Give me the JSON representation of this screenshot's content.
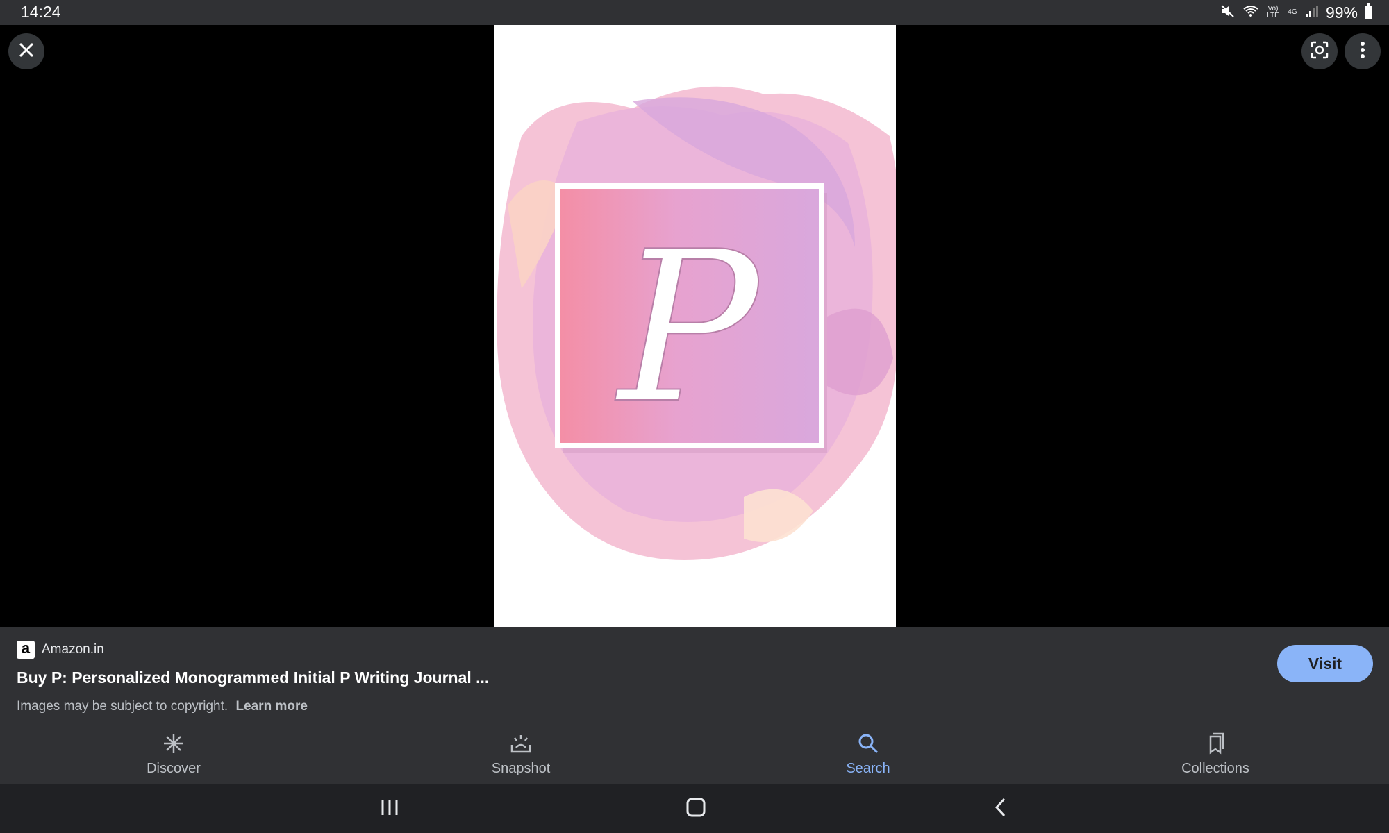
{
  "status_bar": {
    "time": "14:24",
    "battery_percent": "99%",
    "network_volte": "Vo) LTE",
    "network_4g": "4G",
    "icons": [
      "mute-icon",
      "wifi-icon",
      "volte-icon",
      "4g-icon",
      "signal-icon",
      "battery-icon"
    ]
  },
  "viewer": {
    "close_icon": "close-icon",
    "lens_icon": "lens-icon",
    "more_icon": "more-vert-icon",
    "image": {
      "monogram_letter": "P",
      "colors": {
        "frame": "#ffffff",
        "pink": "#f39ab3",
        "lavender": "#d8a8dc"
      }
    }
  },
  "info": {
    "source_logo": "a",
    "source_name": "Amazon.in",
    "title": "Buy P: Personalized Monogrammed Initial P Writing Journal ...",
    "copyright_text": "Images may be subject to copyright.",
    "learn_more": "Learn more",
    "visit_label": "Visit"
  },
  "bottom_nav": {
    "items": [
      {
        "label": "Discover",
        "icon": "discover-icon",
        "active": false
      },
      {
        "label": "Snapshot",
        "icon": "snapshot-icon",
        "active": false
      },
      {
        "label": "Search",
        "icon": "search-icon",
        "active": true
      },
      {
        "label": "Collections",
        "icon": "collections-icon",
        "active": false
      }
    ]
  },
  "system_nav": {
    "icons": [
      "recents-icon",
      "home-icon",
      "back-icon"
    ]
  },
  "colors": {
    "accent": "#8ab4f8",
    "sheet_bg": "#303134",
    "nav_bg": "#202124"
  }
}
